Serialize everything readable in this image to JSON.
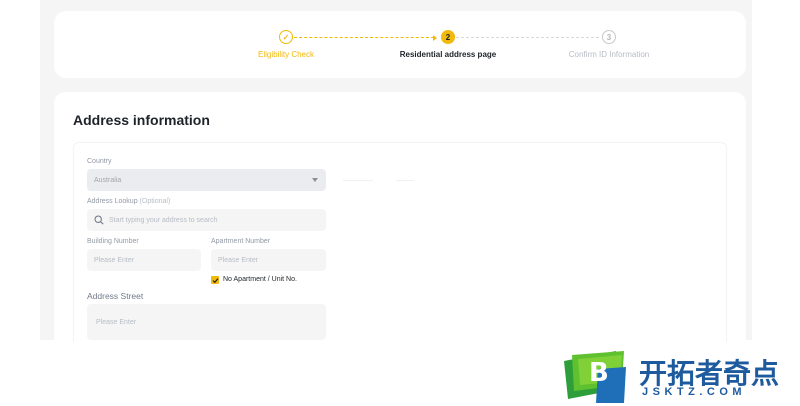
{
  "stepper": {
    "steps": [
      {
        "number": "✓",
        "label": "Eligibility Check",
        "state": "completed"
      },
      {
        "number": "2",
        "label": "Residential address page",
        "state": "active"
      },
      {
        "number": "3",
        "label": "Confirm ID Information",
        "state": "pending"
      }
    ],
    "accent_color": "#f0b90b"
  },
  "address_form": {
    "title": "Address information",
    "country": {
      "label": "Country",
      "value": "Australia"
    },
    "address_lookup": {
      "label": "Address Lookup",
      "optional": "(Optional)",
      "placeholder": "Start typing your address to search"
    },
    "building_number": {
      "label": "Building Number",
      "placeholder": "Please Enter"
    },
    "apartment_number": {
      "label": "Apartment Number",
      "placeholder": "Please Enter"
    },
    "no_apartment": {
      "label": "No Apartment / Unit No.",
      "checked": true
    },
    "address_street": {
      "label": "Address Street",
      "placeholder": "Please Enter"
    }
  },
  "watermark": {
    "cn": "开拓者奇点",
    "en": "JSKTZ.COM",
    "letter": "B"
  }
}
